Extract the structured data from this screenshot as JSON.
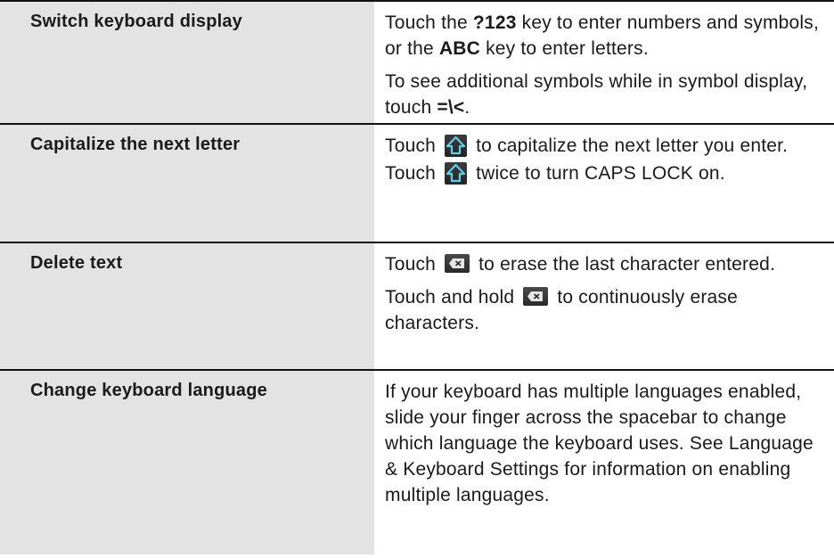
{
  "rows": [
    {
      "task": "Switch keyboard display",
      "p1": {
        "a": "Touch the ",
        "key1": "?123",
        "b": " key to enter numbers and symbols, or the ",
        "key2": "ABC",
        "c": " key to enter letters."
      },
      "p2": {
        "a": "To see additional symbols while in symbol display, touch ",
        "key": "=\\<",
        "b": "."
      }
    },
    {
      "task": "Capitalize the next letter",
      "p1": {
        "a": "Touch",
        "icon": "shift-key-icon",
        "b": "to capitalize the next letter you enter."
      },
      "p2": {
        "a": "Touch",
        "icon": "shift-key-icon",
        "b": "twice to turn CAPS LOCK on."
      }
    },
    {
      "task": "Delete text",
      "p1": {
        "a": "Touch",
        "icon": "delete-key-icon",
        "b": "to erase the last character entered."
      },
      "p2": {
        "a": "Touch and hold",
        "icon": "delete-key-icon",
        "b": "to continuously erase characters."
      }
    },
    {
      "task": "Change keyboard language",
      "p1": "If your keyboard has multiple languages enabled, slide your finger across the spacebar to change which language the keyboard uses. See Language & Keyboard Settings for information on enabling multiple languages."
    }
  ],
  "colors": {
    "task_cell_bg": "#e3e3e3",
    "rule": "#111111",
    "icon_bg": "#2e2e2e",
    "icon_glyph": "#5fd0e6"
  }
}
